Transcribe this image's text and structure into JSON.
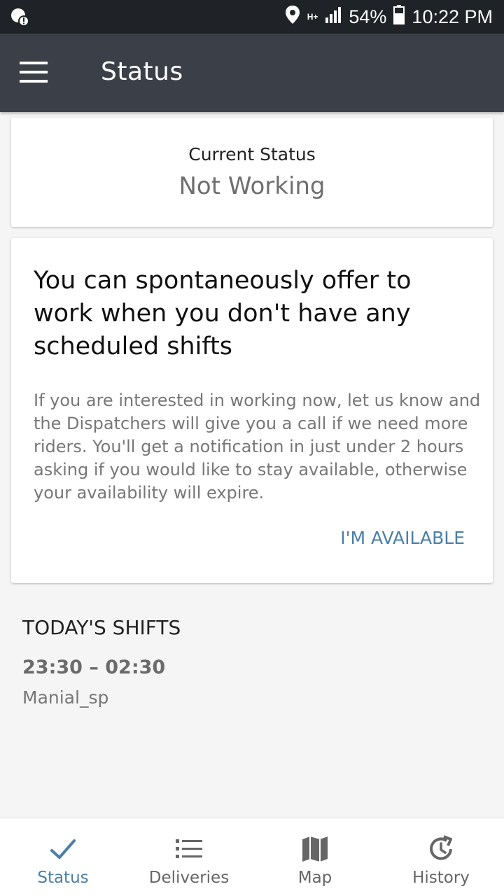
{
  "status_bar": {
    "network": "H+",
    "battery": "54%",
    "time": "10:22 PM"
  },
  "app_bar": {
    "title": "Status"
  },
  "current_status": {
    "label": "Current Status",
    "value": "Not Working"
  },
  "offer_card": {
    "title": "You can spontaneously offer to work when you don't have any scheduled shifts",
    "body": "If you are interested in working now, let us know and the Dispatchers will give you a call if we need more riders. You'll get a notification in just under 2 hours asking if you would like to stay available, otherwise your availability will expire.",
    "button_label": "I'M AVAILABLE"
  },
  "todays_shifts": {
    "heading": "TODAY'S SHIFTS",
    "shifts": [
      {
        "time": "23:30 – 02:30",
        "location": "Manial_sp"
      }
    ]
  },
  "bottom_nav": {
    "items": [
      {
        "label": "Status",
        "icon": "check-icon",
        "active": true
      },
      {
        "label": "Deliveries",
        "icon": "list-icon",
        "active": false
      },
      {
        "label": "Map",
        "icon": "map-icon",
        "active": false
      },
      {
        "label": "History",
        "icon": "history-icon",
        "active": false
      }
    ]
  },
  "colors": {
    "accent": "#4a7fa8",
    "app_bar": "#3a3f48",
    "status_bar": "#1f2227"
  }
}
